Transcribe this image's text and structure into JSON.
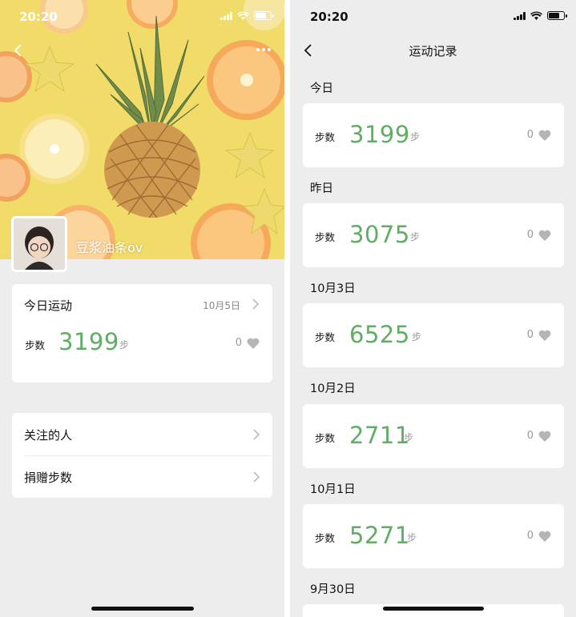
{
  "colors": {
    "accent_green": "#5fae63",
    "muted": "#999999",
    "bg": "#ededed"
  },
  "left": {
    "status": {
      "time": "20:20"
    },
    "header": {
      "back_icon": "chevron-left-icon",
      "more_icon": "more-dots-icon"
    },
    "profile": {
      "username": "豆浆油条ov"
    },
    "today_card": {
      "title": "今日运动",
      "date": "10月5日",
      "steps_label": "步数",
      "steps_value": "3199",
      "steps_unit": "步",
      "likes": "0"
    },
    "menu": [
      {
        "label": "关注的人"
      },
      {
        "label": "捐赠步数"
      }
    ]
  },
  "right": {
    "status": {
      "time": "20:20"
    },
    "title": "运动记录",
    "steps_label": "步数",
    "steps_unit": "步",
    "records": [
      {
        "day": "今日",
        "steps": "3199",
        "likes": "0"
      },
      {
        "day": "昨日",
        "steps": "3075",
        "likes": "0"
      },
      {
        "day": "10月3日",
        "steps": "6525",
        "likes": "0"
      },
      {
        "day": "10月2日",
        "steps": "2711",
        "likes": "0"
      },
      {
        "day": "10月1日",
        "steps": "5271",
        "likes": "0"
      },
      {
        "day": "9月30日"
      }
    ]
  }
}
